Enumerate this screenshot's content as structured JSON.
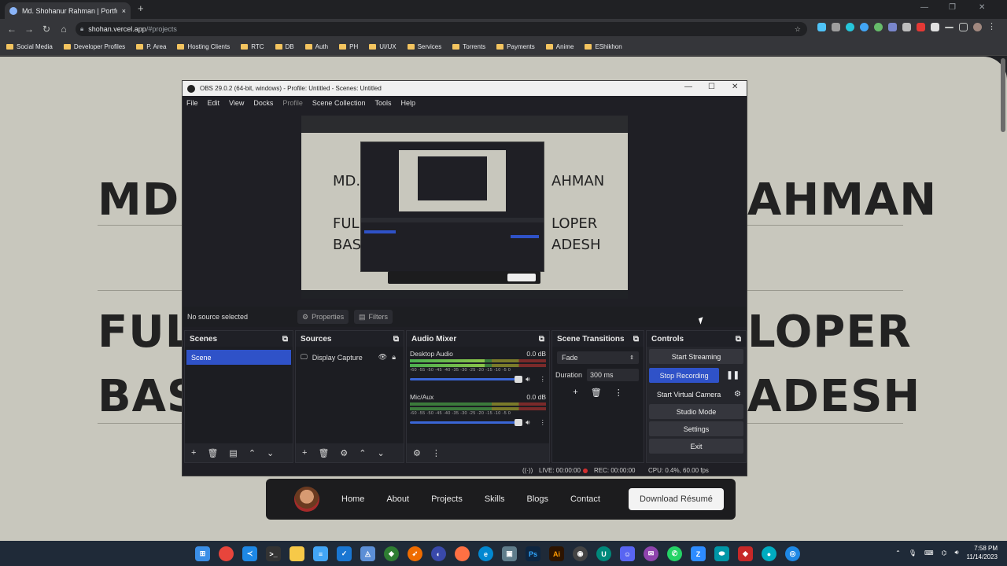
{
  "browser": {
    "tab_title": "Md. Shohanur Rahman | Portfolio",
    "url_host": "shohan.vercel.app",
    "url_path": "/#projects",
    "new_tab_symbol": "+",
    "tab_close_symbol": "×",
    "bookmarks": [
      "Social Media",
      "Developer Profiles",
      "P. Area",
      "Hosting Clients",
      "RTC",
      "DB",
      "Auth",
      "PH",
      "UI/UX",
      "Services",
      "Torrents",
      "Payments",
      "Anime",
      "EShikhon"
    ]
  },
  "website": {
    "line1": "MD. SHOHANUR RAHMAN",
    "line1_left": "MD.",
    "line1_right": "AHMAN",
    "line2_left": "FUL",
    "line2_right": "LOPER",
    "line3_left": "BAS",
    "line3_right": "ADESH",
    "nav": [
      "Home",
      "About",
      "Projects",
      "Skills",
      "Blogs",
      "Contact"
    ],
    "download_button": "Download Résumé"
  },
  "obs": {
    "title": "OBS 29.0.2 (64-bit, windows) - Profile: Untitled - Scenes: Untitled",
    "menu": [
      "File",
      "Edit",
      "View",
      "Docks",
      "Profile",
      "Scene Collection",
      "Tools",
      "Help"
    ],
    "preview_text": {
      "l1": "MD.",
      "l1b": "AHMAN",
      "l2": "FUL",
      "l2b": "LOPER",
      "l3": "BAS",
      "l3b": "ADESH"
    },
    "no_source": "No source selected",
    "properties_btn": "Properties",
    "filters_btn": "Filters",
    "scenes_title": "Scenes",
    "scenes": [
      "Scene"
    ],
    "sources_title": "Sources",
    "sources": [
      "Display Capture"
    ],
    "mixer_title": "Audio Mixer",
    "mixer": [
      {
        "name": "Desktop Audio",
        "db": "0.0 dB",
        "level": 0.55
      },
      {
        "name": "Mic/Aux",
        "db": "0.0 dB",
        "level": 0.0
      }
    ],
    "meter_scale": "-60 -55 -50 -45 -40 -35 -30 -25 -20 -15 -10 -5 0",
    "transitions_title": "Scene Transitions",
    "transition": "Fade",
    "duration_label": "Duration",
    "duration_value": "300 ms",
    "controls_title": "Controls",
    "controls": {
      "start_streaming": "Start Streaming",
      "stop_recording": "Stop Recording",
      "start_virtual_camera": "Start Virtual Camera",
      "studio_mode": "Studio Mode",
      "settings": "Settings",
      "exit": "Exit"
    },
    "status": {
      "live": "LIVE: 00:00:00",
      "rec": "REC: 00:00:00",
      "cpu": "CPU: 0.4%, 60.00 fps"
    }
  },
  "taskbar": {
    "time": "7:58 PM",
    "date": "11/14/2023"
  },
  "colors": {
    "accent": "#2f52c8",
    "site_bg": "#c8c7bd",
    "obs_bg": "#1f1f25"
  }
}
